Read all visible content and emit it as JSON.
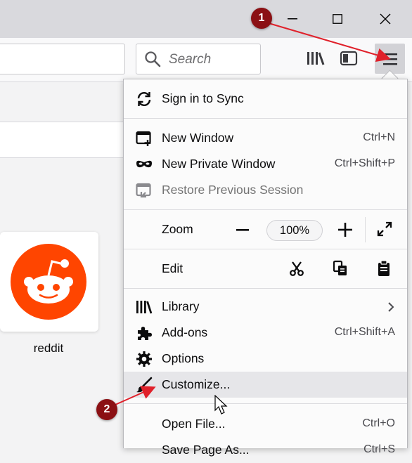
{
  "window": {
    "controls": [
      "minimize-icon",
      "maximize-icon",
      "close-icon"
    ]
  },
  "toolbar": {
    "search_placeholder": "Search",
    "icons": [
      "search-icon",
      "library-icon",
      "sidebar-icon",
      "hamburger-menu-icon"
    ]
  },
  "content": {
    "tile_label": "reddit",
    "tile_logo_color": "#ff4500"
  },
  "menu": {
    "sync": {
      "label": "Sign in to Sync",
      "icon": "sync-icon"
    },
    "new_window": {
      "label": "New Window",
      "shortcut": "Ctrl+N",
      "icon": "new-window-icon"
    },
    "private_window": {
      "label": "New Private Window",
      "shortcut": "Ctrl+Shift+P",
      "icon": "private-mask-icon"
    },
    "restore": {
      "label": "Restore Previous Session",
      "icon": "restore-session-icon"
    },
    "zoom": {
      "label": "Zoom",
      "value": "100%",
      "icons": [
        "zoom-out-icon",
        "zoom-in-icon",
        "fullscreen-icon"
      ]
    },
    "edit": {
      "label": "Edit",
      "icons": [
        "cut-icon",
        "copy-icon",
        "paste-icon"
      ]
    },
    "library": {
      "label": "Library",
      "icon": "library-icon"
    },
    "addons": {
      "label": "Add-ons",
      "shortcut": "Ctrl+Shift+A",
      "icon": "puzzle-icon"
    },
    "options": {
      "label": "Options",
      "icon": "gear-icon"
    },
    "customize": {
      "label": "Customize...",
      "icon": "paintbrush-icon"
    },
    "open_file": {
      "label": "Open File...",
      "shortcut": "Ctrl+O"
    },
    "save_page": {
      "label": "Save Page As...",
      "shortcut": "Ctrl+S"
    }
  },
  "annotations": {
    "step1": "1",
    "step2": "2",
    "color": "#e0202a"
  }
}
